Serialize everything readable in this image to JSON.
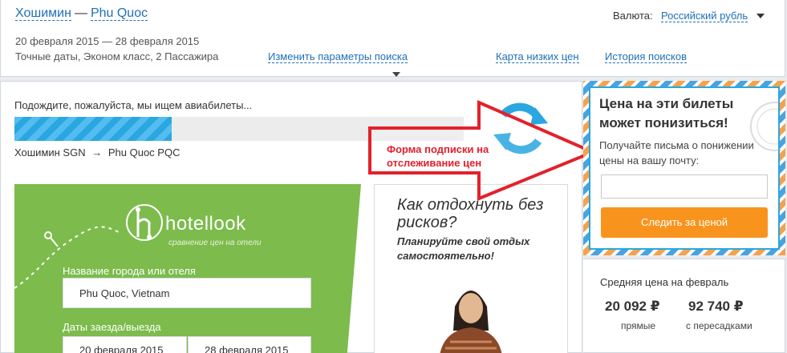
{
  "header": {
    "origin": "Хошимин",
    "separator": "—",
    "destination": "Phu Quoc",
    "dates": "20 февраля 2015 — 28 февраля 2015",
    "params": "Точные даты, Эконом класс, 2 Пассажира",
    "change_link": "Изменить параметры поиска",
    "map_link": "Карта низких цен",
    "history_link": "История поисков",
    "currency_label": "Валюта:",
    "currency_value": "Российский рубль"
  },
  "search": {
    "wait_text": "Подождите, пожалуйста, мы ищем авиабилеты...",
    "progress": 0.35,
    "route_from": "Хошимин SGN",
    "route_arrow": "→",
    "route_to": "Phu Quoc PQC"
  },
  "annotation": {
    "text": "Форма подписки на отслеживание цен",
    "color": "#e3212b"
  },
  "hotel_ad": {
    "brand": "hotellook",
    "tagline": "сравнение цен на отели",
    "city_label": "Название города или отеля",
    "city_value": "Phu Quoc, Vietnam",
    "dates_label": "Даты заезда/выезда",
    "checkin_value": "20 февраля 2015",
    "checkout_value": "28 февраля 2015"
  },
  "travel_ad": {
    "title": "Как отдохнуть без рисков?",
    "subtitle": "Планируйте свой отдых самостоятельно!"
  },
  "subscribe": {
    "title": "Цена на эти билеты может понизиться!",
    "text": "Получайте письма о понижении цены на вашу почту:",
    "email_placeholder": "",
    "button": "Следить за ценой"
  },
  "avg_price": {
    "title": "Средняя цена на февраль",
    "direct_price": "20 092 ₽",
    "direct_label": "прямые",
    "transfer_price": "92 740 ₽",
    "transfer_label": "с пересадками"
  },
  "colors": {
    "link": "#1f6fb5",
    "progress": "#2aa6e0",
    "button": "#f8941d",
    "hotel_green": "#7cbb4c"
  }
}
